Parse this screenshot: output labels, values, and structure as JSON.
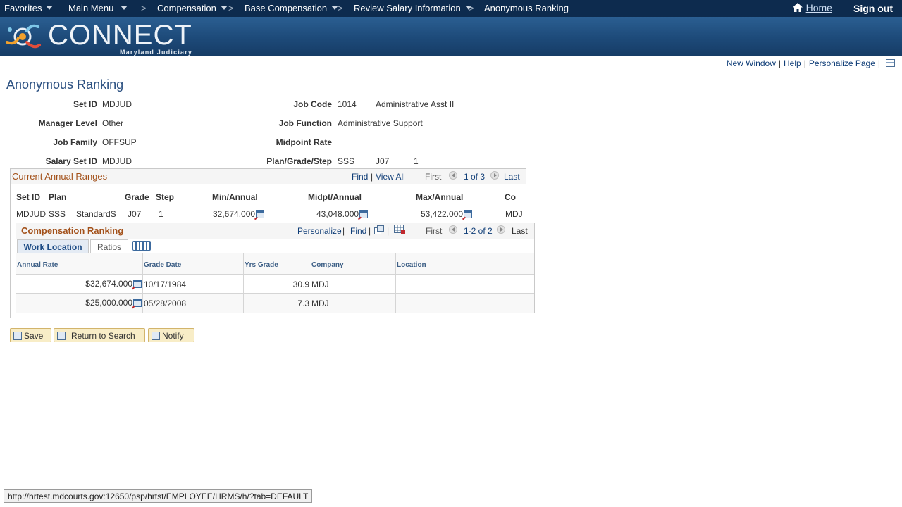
{
  "topnav": {
    "favorites": "Favorites",
    "main_menu": "Main Menu",
    "crumb_compensation": "Compensation",
    "crumb_base_comp": "Base Compensation",
    "crumb_review": "Review Salary Information",
    "crumb_current": "Anonymous Ranking",
    "home": "Home",
    "sign_out": "Sign out",
    "separator": ">"
  },
  "banner": {
    "logo_text": "CONNECT",
    "logo_sub": "Maryland Judiciary"
  },
  "page_links": {
    "new_window": "New Window",
    "help": "Help",
    "personalize_page": "Personalize Page",
    "bar": "|"
  },
  "page_title": "Anonymous Ranking",
  "fields": {
    "set_id_label": "Set ID",
    "set_id": "MDJUD",
    "manager_level_label": "Manager Level",
    "manager_level": "Other",
    "job_family_label": "Job Family",
    "job_family": "OFFSUP",
    "salary_set_id_label": "Salary Set ID",
    "salary_set_id": "MDJUD",
    "job_code_label": "Job Code",
    "job_code": "1014",
    "job_code_desc": "Administrative Asst II",
    "job_function_label": "Job Function",
    "job_function": "Administrative Support",
    "midpoint_rate_label": "Midpoint Rate",
    "plan_grade_step_label": "Plan/Grade/Step",
    "plan": "SSS",
    "grade": "J07",
    "step": "1"
  },
  "annual_ranges": {
    "title": "Current Annual Ranges",
    "find": "Find",
    "view_all": "View All",
    "first": "First",
    "count": "1 of 3",
    "last": "Last",
    "headers": {
      "setid": "Set ID",
      "plan": "Plan",
      "grade": "Grade",
      "step": "Step",
      "min": "Min/Annual",
      "midpt": "Midpt/Annual",
      "max": "Max/Annual",
      "co": "Co"
    },
    "row": {
      "setid": "MDJUD",
      "plan": "SSS",
      "plan_desc": "StandardS",
      "grade": "J07",
      "step": "1",
      "min": "32,674.000",
      "midpt": "43,048.000",
      "max": "53,422.000",
      "co": "MDJ"
    }
  },
  "comp_ranking": {
    "title": "Compensation Ranking",
    "personalize": "Personalize",
    "find": "Find",
    "first": "First",
    "count": "1-2 of 2",
    "last": "Last",
    "tabs": [
      "Work Location",
      "Ratios"
    ],
    "headers": [
      "Annual Rate",
      "Grade Date",
      "Yrs Grade",
      "Company",
      "Location"
    ],
    "rows": [
      {
        "rate": "$32,674.000",
        "date": "10/17/1984",
        "yrs": "30.9",
        "company": "MDJ",
        "location": ""
      },
      {
        "rate": "$25,000.000",
        "date": "05/28/2008",
        "yrs": "7.3",
        "company": "MDJ",
        "location": ""
      }
    ]
  },
  "buttons": {
    "save": "Save",
    "return_to_search": "Return to Search",
    "notify": "Notify"
  },
  "status_url": "http://hrtest.mdcourts.gov:12650/psp/hrtst/EMPLOYEE/HRMS/h/?tab=DEFAULT"
}
